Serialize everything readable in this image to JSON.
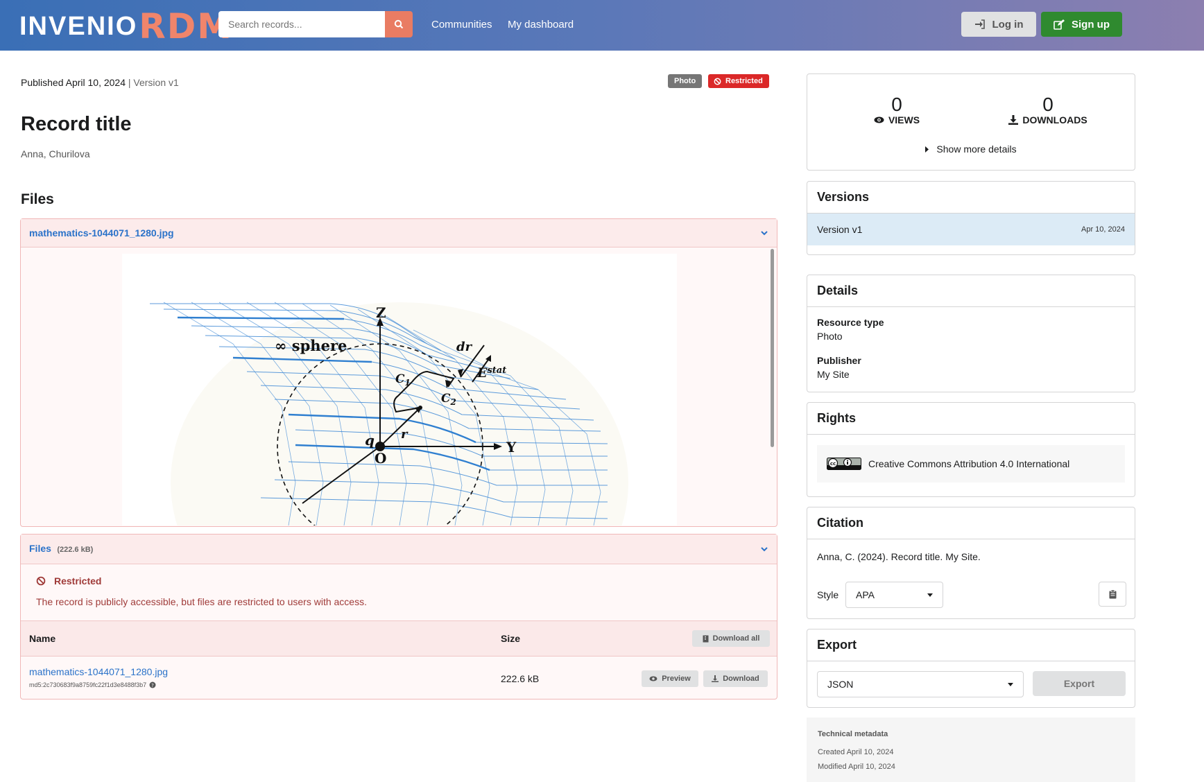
{
  "header": {
    "logo_main": "INVENIO",
    "logo_accent": "RDM",
    "search_placeholder": "Search records...",
    "nav": [
      "Communities",
      "My dashboard"
    ],
    "login_label": "Log in",
    "signup_label": "Sign up"
  },
  "record": {
    "published": "Published April 10, 2024",
    "version": "Version v1",
    "badges": {
      "type": "Photo",
      "access": "Restricted"
    },
    "title": "Record title",
    "authors": "Anna, Churilova"
  },
  "files_section": {
    "heading": "Files",
    "preview_file": "mathematics-1044071_1280.jpg",
    "list_title": "Files",
    "list_size": "(222.6 kB)",
    "restricted_title": "Restricted",
    "restricted_text": "The record is publicly accessible, but files are restricted to users with access.",
    "col_name": "Name",
    "col_size": "Size",
    "download_all": "Download all",
    "rows": [
      {
        "name": "mathematics-1044071_1280.jpg",
        "md5": "md5:2c730683f9a8759fc22f1d3e8488f3b7",
        "size": "222.6 kB",
        "preview": "Preview",
        "download": "Download"
      }
    ]
  },
  "preview_figure": {
    "z": "Z",
    "y": "Y",
    "o": "O",
    "q": "q",
    "sphere": "∞ sphere",
    "c1": "C",
    "c1_sub": "1",
    "c2": "C",
    "c2_sub": "2",
    "dr": "dr",
    "r": "r",
    "e": "E",
    "e_sup": "stat"
  },
  "sidebar": {
    "views_count": "0",
    "views_label": "VIEWS",
    "downloads_count": "0",
    "downloads_label": "DOWNLOADS",
    "show_more": "Show more details",
    "versions": {
      "title": "Versions",
      "items": [
        {
          "label": "Version v1",
          "date": "Apr 10, 2024"
        }
      ]
    },
    "details": {
      "title": "Details",
      "resource_type_label": "Resource type",
      "resource_type": "Photo",
      "publisher_label": "Publisher",
      "publisher": "My Site"
    },
    "rights": {
      "title": "Rights",
      "license": "Creative Commons Attribution 4.0 International"
    },
    "citation": {
      "title": "Citation",
      "text": "Anna, C. (2024). Record title. My Site.",
      "style_label": "Style",
      "style_value": "APA"
    },
    "export": {
      "title": "Export",
      "format": "JSON",
      "button": "Export"
    },
    "technical": {
      "title": "Technical metadata",
      "created": "Created April 10, 2024",
      "modified": "Modified April 10, 2024"
    }
  },
  "colors": {
    "header_gradient_start": "#3a6fb6",
    "header_gradient_end": "#8c7fb0",
    "accent_orange": "#e97c63",
    "signup_green": "#2f8a2f",
    "restricted_red": "#db2828",
    "link_blue": "#2a72c9"
  }
}
